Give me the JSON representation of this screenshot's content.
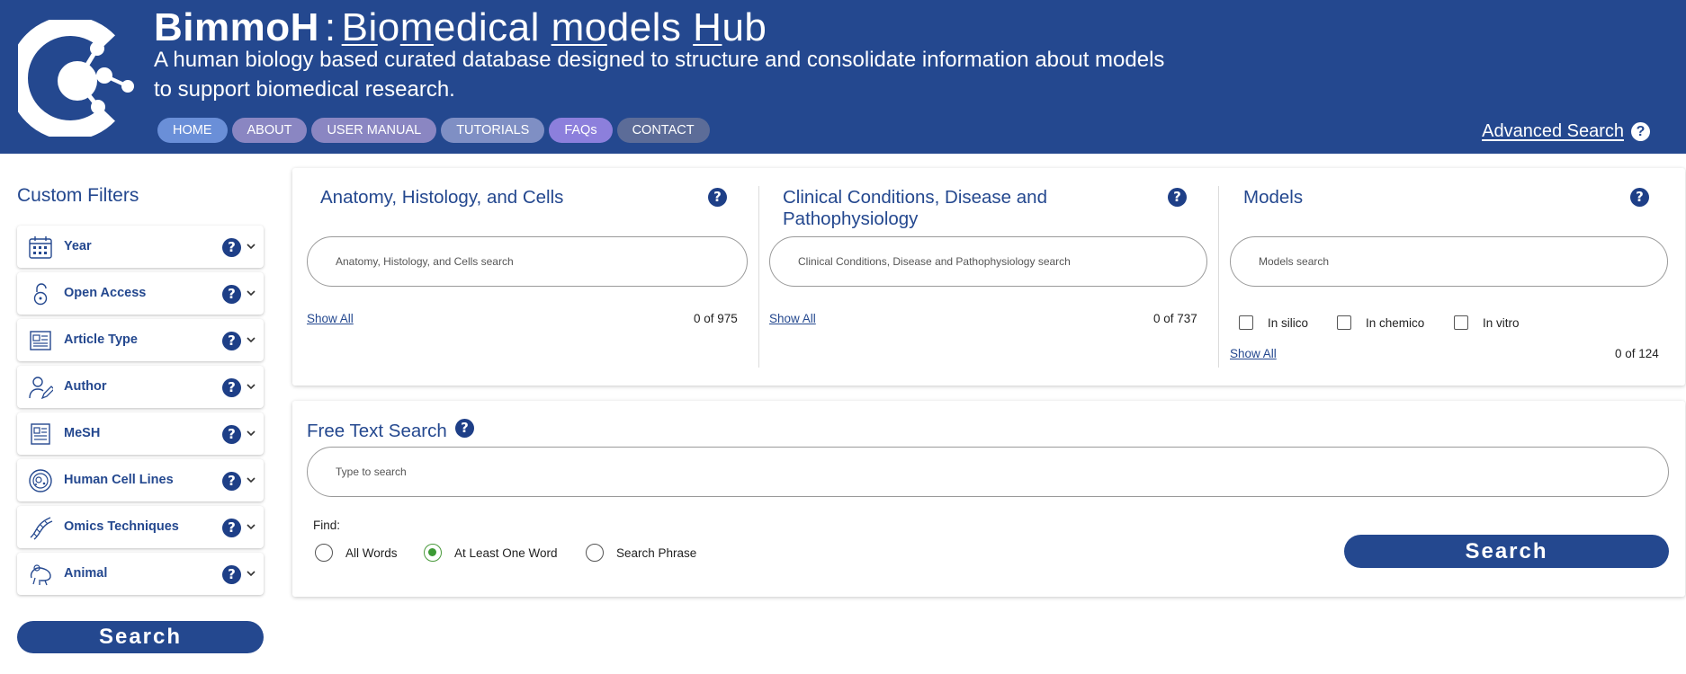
{
  "brand": {
    "short": "BimmoH",
    "separator": ":",
    "full_name": [
      {
        "u": "Bi",
        "t": "o"
      },
      {
        "u": "m",
        "t": "edical "
      },
      {
        "u": "mo",
        "t": "dels "
      },
      {
        "u": "H",
        "t": "ub"
      }
    ],
    "tagline": "A human biology based curated database designed to structure and consolidate information about models to support biomedical research."
  },
  "nav": [
    {
      "label": "HOME",
      "color": "#6a8fd8"
    },
    {
      "label": "ABOUT",
      "color": "#8a86c2"
    },
    {
      "label": "USER MANUAL",
      "color": "#8a86c2"
    },
    {
      "label": "TUTORIALS",
      "color": "#7f8fc4"
    },
    {
      "label": "FAQs",
      "color": "#8c7fdc"
    },
    {
      "label": "CONTACT",
      "color": "#5c6c98"
    }
  ],
  "advanced_search": {
    "label": "Advanced Search",
    "help": "?"
  },
  "sidebar": {
    "title": "Custom Filters",
    "items": [
      {
        "label": "Year",
        "icon": "calendar-icon"
      },
      {
        "label": "Open Access",
        "icon": "unlock-icon"
      },
      {
        "label": "Article Type",
        "icon": "article-icon"
      },
      {
        "label": "Author",
        "icon": "author-icon"
      },
      {
        "label": "MeSH",
        "icon": "document-icon"
      },
      {
        "label": "Human Cell Lines",
        "icon": "cell-icon"
      },
      {
        "label": "Omics Techniques",
        "icon": "dna-icon"
      },
      {
        "label": "Animal",
        "icon": "animal-icon"
      }
    ],
    "search_label": "Search"
  },
  "columns": {
    "anatomy": {
      "title": "Anatomy, Histology, and Cells",
      "placeholder": "Anatomy, Histology, and Cells search",
      "show_all": "Show All",
      "count": "0 of 975"
    },
    "clinical": {
      "title": "Clinical Conditions, Disease and Pathophysiology",
      "placeholder": "Clinical Conditions, Disease and Pathophysiology search",
      "show_all": "Show All",
      "count": "0 of 737"
    },
    "models": {
      "title": "Models",
      "placeholder": "Models search",
      "show_all": "Show All",
      "count": "0 of 124",
      "checkboxes": [
        "In silico",
        "In chemico",
        "In vitro"
      ]
    }
  },
  "free_text": {
    "title": "Free Text Search",
    "placeholder": "Type to search",
    "find_label": "Find:",
    "options": [
      "All Words",
      "At Least One Word",
      "Search Phrase"
    ],
    "selected": "At Least One Word",
    "search_label": "Search"
  },
  "help_glyph": "?"
}
